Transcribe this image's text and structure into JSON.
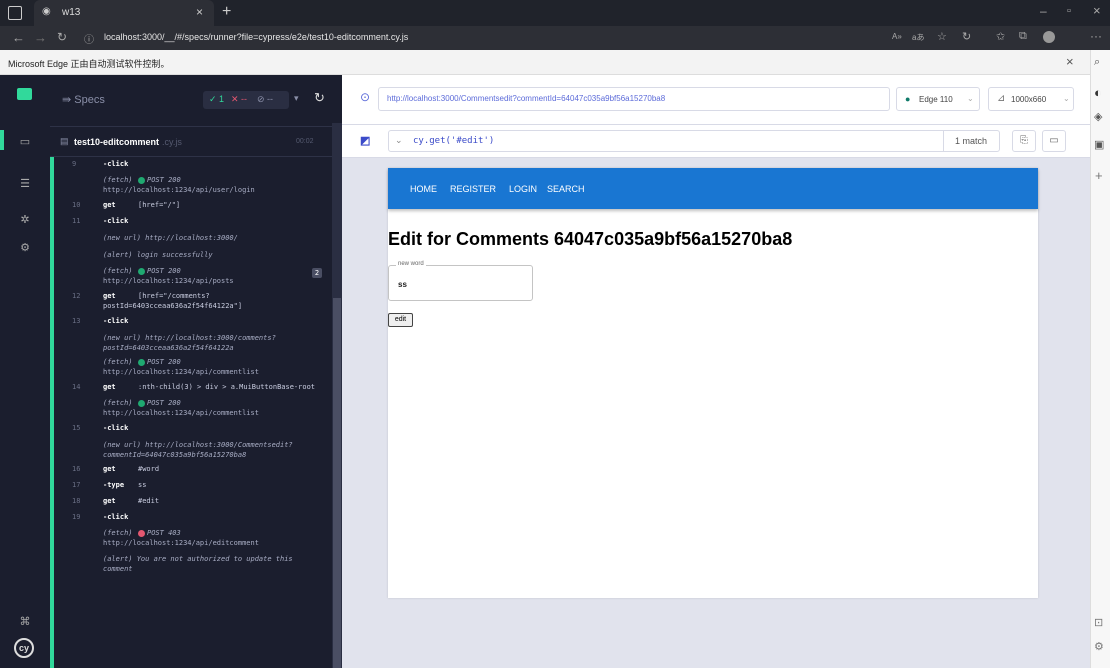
{
  "tab": {
    "title": "w13"
  },
  "address": {
    "url": "localhost:3000/__/#/specs/runner?file=cypress/e2e/test10-editcomment.cy.js"
  },
  "infobar": {
    "message": "Microsoft Edge 正由自动测试软件控制。"
  },
  "reporter": {
    "specs_label": "Specs",
    "passed": "1",
    "failed": "--",
    "pending": "--",
    "spec_name": "test10-editcomment",
    "spec_ext": ".cy.js",
    "duration": "00:02"
  },
  "commands": [
    {
      "num": "9",
      "name": "-click",
      "msg": ""
    },
    {
      "sub": "(fetch)",
      "status": "POST 200",
      "status_color": "#1fa971",
      "url": "http://localhost:1234/api/user/login"
    },
    {
      "num": "10",
      "name": "get",
      "msg": "[href=\"/\"]"
    },
    {
      "num": "11",
      "name": "-click",
      "msg": ""
    },
    {
      "sub": "(new url)  http://localhost:3000/"
    },
    {
      "sub": "(alert)  login successfully"
    },
    {
      "sub": "(fetch)",
      "status": "POST 200",
      "status_color": "#1fa971",
      "url": "http://localhost:1234/api/posts",
      "badge": "2"
    },
    {
      "num": "12",
      "name": "get",
      "msg": "[href=\"/comments?",
      "msg2": "postId=6403cceaa636a2f54f64122a\"]"
    },
    {
      "num": "13",
      "name": "-click",
      "msg": ""
    },
    {
      "sub": "(new url)  http://localhost:3000/comments?",
      "sub2": "postId=6403cceaa636a2f54f64122a"
    },
    {
      "sub": "(fetch)",
      "status": "POST 200",
      "status_color": "#1fa971",
      "url": "http://localhost:1234/api/commentlist"
    },
    {
      "num": "14",
      "name": "get",
      "msg": ":nth-child(3) > div > a.MuiButtonBase-root"
    },
    {
      "sub": "(fetch)",
      "status": "POST 200",
      "status_color": "#1fa971",
      "url": "http://localhost:1234/api/commentlist"
    },
    {
      "num": "15",
      "name": "-click",
      "msg": ""
    },
    {
      "sub": "(new url)  http://localhost:3000/Commentsedit?",
      "sub2": "commentId=64047c035a9bf56a15270ba8"
    },
    {
      "num": "16",
      "name": "get",
      "msg": "#word"
    },
    {
      "num": "17",
      "name": "-type",
      "msg": "ss"
    },
    {
      "num": "18",
      "name": "get",
      "msg": "#edit"
    },
    {
      "num": "19",
      "name": "-click",
      "msg": ""
    },
    {
      "sub": "(fetch)",
      "status": "POST 403",
      "status_color": "#e45770",
      "url": "http://localhost:1234/api/editcomment"
    },
    {
      "sub": "(alert)  You are not authorized to update this",
      "sub2": "comment"
    }
  ],
  "aut": {
    "url": "http://localhost:3000/Commentsedit?commentId=64047c035a9bf56a15270ba8",
    "browser": "Edge 110",
    "viewport": "1000x660",
    "selector": "cy.get('#edit')",
    "match_count": "1 match"
  },
  "app": {
    "nav": [
      "HOME",
      "REGISTER",
      "LOGIN",
      "SEARCH"
    ],
    "heading": "Edit for Comments 64047c035a9bf56a15270ba8",
    "field_label": "new word",
    "field_value": "ss",
    "button": "edit"
  }
}
